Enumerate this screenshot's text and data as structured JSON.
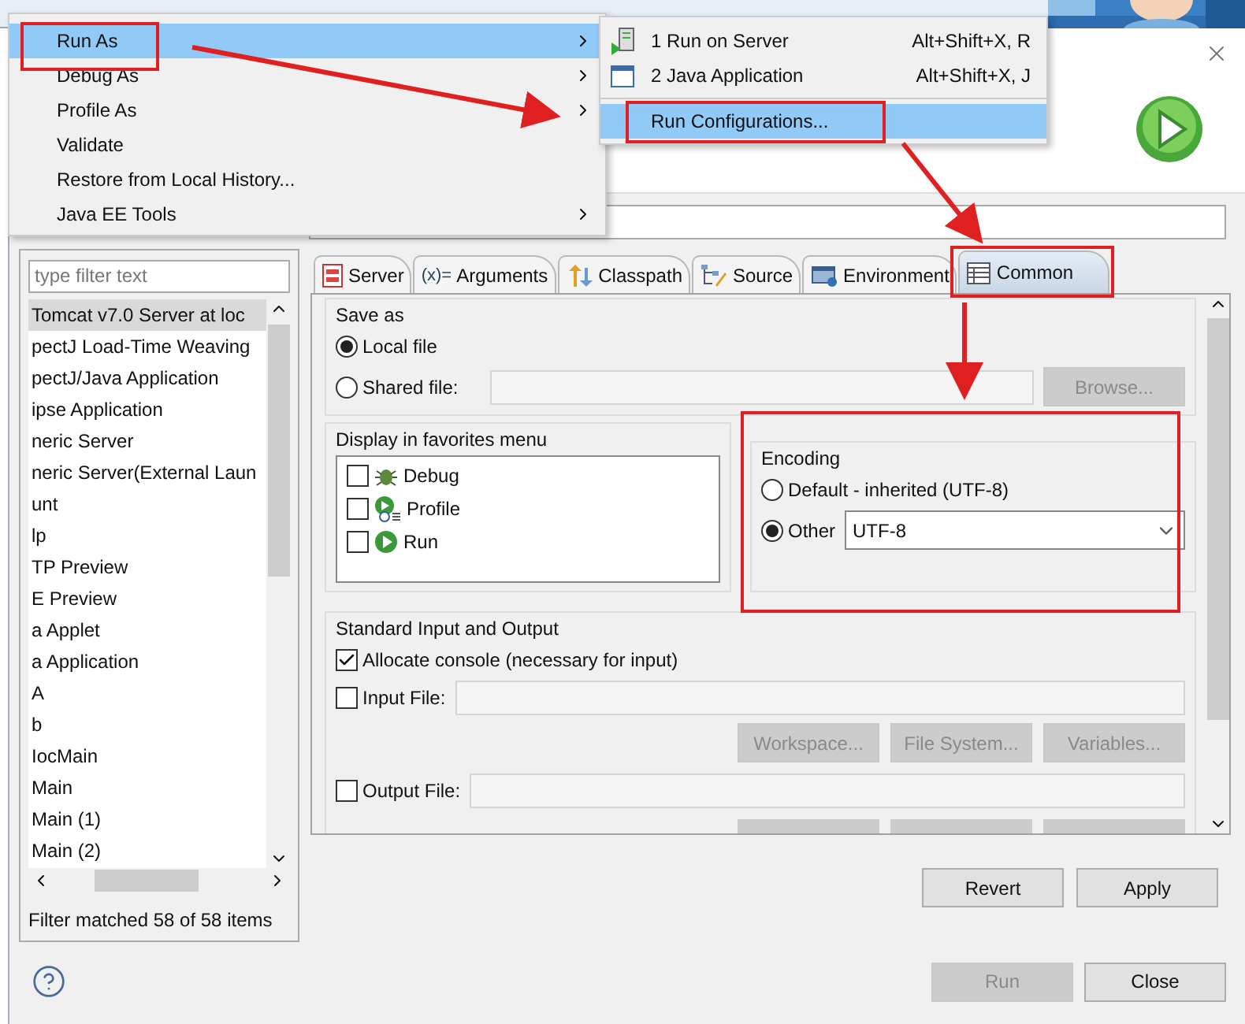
{
  "context_menu": {
    "items": [
      {
        "label": "Run As",
        "submenu": true,
        "selected": true
      },
      {
        "label": "Debug As",
        "submenu": true,
        "selected": false
      },
      {
        "label": "Profile As",
        "submenu": true,
        "selected": false
      },
      {
        "label": "Validate",
        "submenu": false,
        "selected": false
      },
      {
        "label": "Restore from Local History...",
        "submenu": false,
        "selected": false
      },
      {
        "label": "Java EE Tools",
        "submenu": true,
        "selected": false
      }
    ]
  },
  "submenu": {
    "items": [
      {
        "kind": "server",
        "label": "1 Run on Server",
        "shortcut": "Alt+Shift+X, R",
        "selected": false
      },
      {
        "kind": "java",
        "label": "2 Java Application",
        "shortcut": "Alt+Shift+X, J",
        "selected": false
      },
      {
        "kind": "separator"
      },
      {
        "kind": "plain",
        "label": "Run Configurations...",
        "selected": true
      }
    ]
  },
  "dialog": {
    "filter": {
      "placeholder": "type filter text"
    },
    "configs": [
      {
        "label": "Tomcat v7.0 Server at loc",
        "selected": true
      },
      {
        "label": "pectJ Load-Time Weaving",
        "selected": false
      },
      {
        "label": "pectJ/Java Application",
        "selected": false
      },
      {
        "label": "ipse Application",
        "selected": false
      },
      {
        "label": "neric Server",
        "selected": false
      },
      {
        "label": "neric Server(External Laun",
        "selected": false
      },
      {
        "label": "unt",
        "selected": false
      },
      {
        "label": "lp",
        "selected": false
      },
      {
        "label": "TP Preview",
        "selected": false
      },
      {
        "label": "E Preview",
        "selected": false
      },
      {
        "label": "a Applet",
        "selected": false
      },
      {
        "label": "a Application",
        "selected": false
      },
      {
        "label": "A",
        "selected": false
      },
      {
        "label": "b",
        "selected": false
      },
      {
        "label": "IocMain",
        "selected": false
      },
      {
        "label": "Main",
        "selected": false
      },
      {
        "label": "Main (1)",
        "selected": false
      },
      {
        "label": "Main (2)",
        "selected": false
      }
    ],
    "status": "Filter matched 58 of 58 items",
    "tabs": [
      {
        "kind": "server",
        "label": "Server",
        "selected": false
      },
      {
        "kind": "text",
        "icon_text": "(x)=",
        "label": "Arguments",
        "selected": false
      },
      {
        "kind": "classpath",
        "label": "Classpath",
        "selected": false
      },
      {
        "kind": "source",
        "label": "Source",
        "selected": false
      },
      {
        "kind": "environment",
        "label": "Environment",
        "selected": false
      },
      {
        "kind": "common",
        "label": "Common",
        "selected": true
      }
    ],
    "save_as": {
      "title": "Save as",
      "options": [
        {
          "label": "Local file",
          "selected": true
        },
        {
          "label": "Shared file:",
          "selected": false
        }
      ],
      "browse": {
        "label": "Browse...",
        "disabled": true
      }
    },
    "favorites": {
      "title": "Display in favorites menu",
      "items": [
        {
          "kind": "debug",
          "label": "Debug",
          "checked": false
        },
        {
          "kind": "profile",
          "label": "Profile",
          "checked": false
        },
        {
          "kind": "run",
          "label": "Run",
          "checked": false
        }
      ]
    },
    "encoding": {
      "title": "Encoding",
      "options": [
        {
          "label": "Default - inherited (UTF-8)",
          "selected": false
        },
        {
          "label": "Other",
          "selected": true
        }
      ],
      "value": "UTF-8"
    },
    "io": {
      "title": "Standard Input and Output",
      "allocate": {
        "label": "Allocate console (necessary for input)",
        "checked": true
      },
      "input": {
        "label": "Input File:",
        "checked": false
      },
      "buttons": [
        {
          "label": "Workspace...",
          "disabled": true
        },
        {
          "label": "File System...",
          "disabled": true
        },
        {
          "label": "Variables...",
          "disabled": true
        }
      ],
      "output": {
        "label": "Output File:",
        "checked": false
      }
    },
    "actions": [
      {
        "label": "Revert",
        "disabled": false
      },
      {
        "label": "Apply",
        "disabled": false
      }
    ],
    "footer": [
      {
        "label": "Run",
        "disabled": true
      },
      {
        "label": "Close",
        "disabled": false
      }
    ]
  }
}
